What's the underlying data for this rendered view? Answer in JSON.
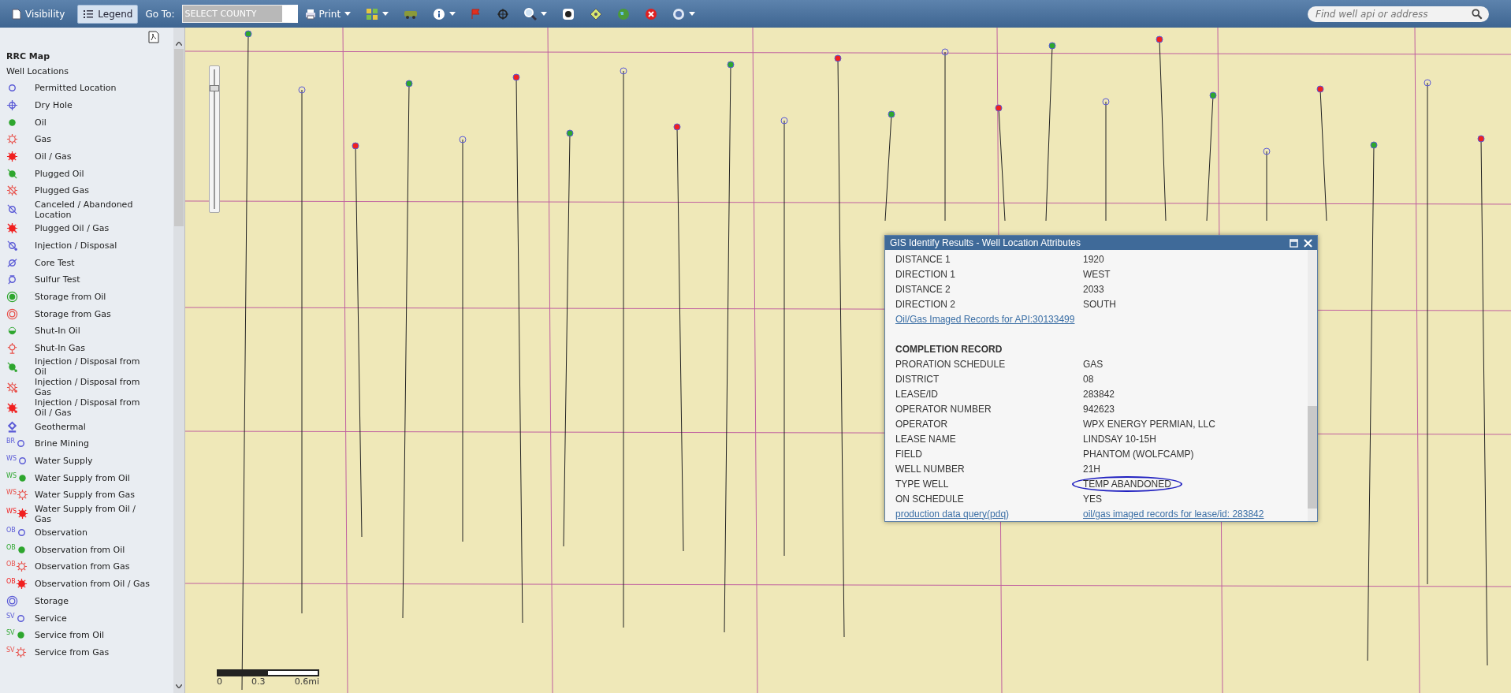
{
  "toolbar": {
    "tabs": [
      {
        "label": "Visibility",
        "selected": false
      },
      {
        "label": "Legend",
        "selected": true
      }
    ],
    "goto_label": "Go To:",
    "county_select": "SELECT COUNTY",
    "print_label": "Print",
    "search": {
      "placeholder": "Find well api or address"
    }
  },
  "legend": {
    "title": "RRC Map",
    "group": "Well Locations",
    "items": [
      {
        "label": "Permitted Location",
        "kind": "ring",
        "color": "#5a5ad6"
      },
      {
        "label": "Dry Hole",
        "kind": "crosshair",
        "color": "#5a5ad6"
      },
      {
        "label": "Oil",
        "kind": "dot",
        "color": "#2ea62e"
      },
      {
        "label": "Gas",
        "kind": "sun",
        "color": "#e8504a"
      },
      {
        "label": "Oil / Gas",
        "kind": "sunfill",
        "color": "#f02020"
      },
      {
        "label": "Plugged Oil",
        "kind": "dot-slash",
        "color": "#2ea62e"
      },
      {
        "label": "Plugged Gas",
        "kind": "sun-slash",
        "color": "#e8504a"
      },
      {
        "label": "Canceled / Abandoned Location",
        "kind": "ring-slash",
        "color": "#5a5ad6"
      },
      {
        "label": "Plugged Oil / Gas",
        "kind": "sunfill-slash",
        "color": "#f02020"
      },
      {
        "label": "Injection / Disposal",
        "kind": "ring-arrow",
        "color": "#5a5ad6"
      },
      {
        "label": "Core Test",
        "kind": "ring-core",
        "color": "#5a5ad6"
      },
      {
        "label": "Sulfur Test",
        "kind": "ring-sulfur",
        "color": "#5a5ad6"
      },
      {
        "label": "Storage from Oil",
        "kind": "target",
        "color": "#2ea62e"
      },
      {
        "label": "Storage from Gas",
        "kind": "double-ring",
        "color": "#e8504a"
      },
      {
        "label": "Shut-In Oil",
        "kind": "half-dot",
        "color": "#2ea62e"
      },
      {
        "label": "Shut-In Gas",
        "kind": "shut",
        "color": "#e8504a"
      },
      {
        "label": "Injection / Disposal from Oil",
        "kind": "dot-arrow",
        "color": "#2ea62e"
      },
      {
        "label": "Injection / Disposal from Gas",
        "kind": "sun-arrow",
        "color": "#e8504a"
      },
      {
        "label": "Injection / Disposal from Oil / Gas",
        "kind": "sunfill-arrow",
        "color": "#f02020"
      },
      {
        "label": "Geothermal",
        "kind": "geo",
        "color": "#5a5ad6"
      },
      {
        "label": "Brine Mining",
        "kind": "ring",
        "color": "#5a5ad6",
        "prefix": "BR"
      },
      {
        "label": "Water Supply",
        "kind": "ring",
        "color": "#5a5ad6",
        "prefix": "WS"
      },
      {
        "label": "Water Supply from Oil",
        "kind": "dot",
        "color": "#2ea62e",
        "prefix": "WS"
      },
      {
        "label": "Water Supply from Gas",
        "kind": "sun",
        "color": "#e8504a",
        "prefix": "WS"
      },
      {
        "label": "Water Supply from Oil / Gas",
        "kind": "sunfill",
        "color": "#f02020",
        "prefix": "WS"
      },
      {
        "label": "Observation",
        "kind": "ring",
        "color": "#5a5ad6",
        "prefix": "OB"
      },
      {
        "label": "Observation from Oil",
        "kind": "dot",
        "color": "#2ea62e",
        "prefix": "OB"
      },
      {
        "label": "Observation from Gas",
        "kind": "sun",
        "color": "#e8504a",
        "prefix": "OB"
      },
      {
        "label": "Observation from Oil / Gas",
        "kind": "sunfill",
        "color": "#f02020",
        "prefix": "OB"
      },
      {
        "label": "Storage",
        "kind": "double-ring",
        "color": "#5a5ad6"
      },
      {
        "label": "Service",
        "kind": "ring",
        "color": "#5a5ad6",
        "prefix": "SV"
      },
      {
        "label": "Service from Oil",
        "kind": "dot",
        "color": "#2ea62e",
        "prefix": "SV"
      },
      {
        "label": "Service from Gas",
        "kind": "sun",
        "color": "#e8504a",
        "prefix": "SV"
      }
    ]
  },
  "map": {
    "zoom_slider": {
      "level": 0.88
    },
    "scale_bar": [
      "0",
      "0.3",
      "0.6mi"
    ]
  },
  "popup": {
    "title": "GIS Identify Results - Well Location Attributes",
    "rows": [
      {
        "kind": "pair",
        "label": "DISTANCE 1",
        "value": "1920"
      },
      {
        "kind": "pair",
        "label": "DIRECTION 1",
        "value": "WEST"
      },
      {
        "kind": "pair",
        "label": "DISTANCE 2",
        "value": "2033"
      },
      {
        "kind": "pair",
        "label": "DIRECTION 2",
        "value": "SOUTH"
      },
      {
        "kind": "link",
        "label": "Oil/Gas Imaged Records for API:30133499"
      },
      {
        "kind": "heading",
        "label": "COMPLETION RECORD"
      },
      {
        "kind": "pair",
        "label": "PRORATION SCHEDULE",
        "value": "GAS"
      },
      {
        "kind": "pair",
        "label": "DISTRICT",
        "value": "08"
      },
      {
        "kind": "pair",
        "label": "LEASE/ID",
        "value": "283842"
      },
      {
        "kind": "pair",
        "label": "OPERATOR NUMBER",
        "value": "942623"
      },
      {
        "kind": "pair",
        "label": "OPERATOR",
        "value": "WPX ENERGY PERMIAN, LLC"
      },
      {
        "kind": "pair",
        "label": "LEASE NAME",
        "value": "LINDSAY 10-15H"
      },
      {
        "kind": "pair",
        "label": "FIELD",
        "value": "PHANTOM (WOLFCAMP)"
      },
      {
        "kind": "pair",
        "label": "WELL NUMBER",
        "value": "21H"
      },
      {
        "kind": "pair",
        "label": "TYPE WELL",
        "value": "TEMP ABANDONED",
        "circled": true
      },
      {
        "kind": "pair",
        "label": "ON SCHEDULE",
        "value": "YES"
      },
      {
        "kind": "links",
        "label": "production data query(pdq)",
        "value": "oil/gas imaged records for lease/id: 283842"
      }
    ]
  }
}
